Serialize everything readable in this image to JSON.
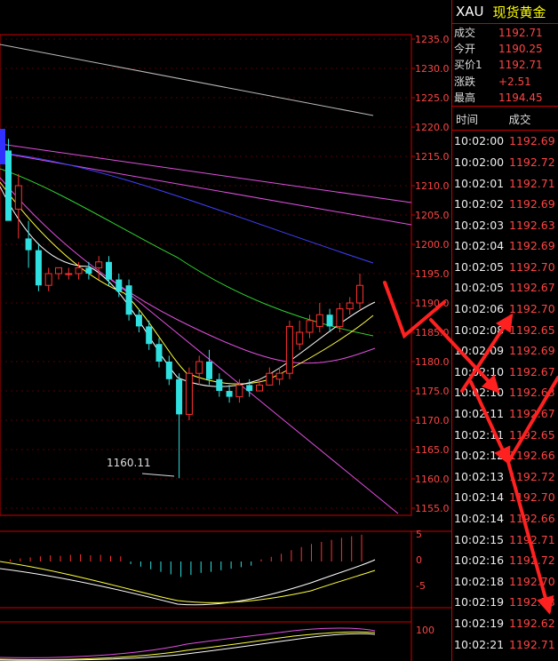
{
  "symbol": "XAU",
  "instrument_name": "现货黄金",
  "quote": [
    {
      "label": "成交",
      "value": "1192.71"
    },
    {
      "label": "今开",
      "value": "1190.25"
    },
    {
      "label": "买价1",
      "value": "1192.71"
    },
    {
      "label": "涨跌",
      "value": "+2.51"
    },
    {
      "label": "最高",
      "value": "1194.45"
    }
  ],
  "ticks_header": {
    "time": "时间",
    "price": "成交"
  },
  "ticks": [
    {
      "time": "10:02:00",
      "price": "1192.69"
    },
    {
      "time": "10:02:00",
      "price": "1192.72"
    },
    {
      "time": "10:02:01",
      "price": "1192.71"
    },
    {
      "time": "10:02:02",
      "price": "1192.69"
    },
    {
      "time": "10:02:03",
      "price": "1192.63"
    },
    {
      "time": "10:02:04",
      "price": "1192.69"
    },
    {
      "time": "10:02:05",
      "price": "1192.70"
    },
    {
      "time": "10:02:05",
      "price": "1192.67"
    },
    {
      "time": "10:02:06",
      "price": "1192.70"
    },
    {
      "time": "10:02:08",
      "price": "1192.65"
    },
    {
      "time": "10:02:09",
      "price": "1192.69"
    },
    {
      "time": "10:02:10",
      "price": "1192.67"
    },
    {
      "time": "10:02:10",
      "price": "1192.63"
    },
    {
      "time": "10:02:11",
      "price": "1192.67"
    },
    {
      "time": "10:02:11",
      "price": "1192.65"
    },
    {
      "time": "10:02:12",
      "price": "1192.66"
    },
    {
      "time": "10:02:13",
      "price": "1192.72"
    },
    {
      "time": "10:02:14",
      "price": "1192.70"
    },
    {
      "time": "10:02:14",
      "price": "1192.66"
    },
    {
      "time": "10:02:15",
      "price": "1192.71"
    },
    {
      "time": "10:02:16",
      "price": "1192.72"
    },
    {
      "time": "10:02:18",
      "price": "1192.70"
    },
    {
      "time": "10:02:19",
      "price": "1192.78"
    },
    {
      "time": "10:02:19",
      "price": "1192.62"
    },
    {
      "time": "10:02:21",
      "price": "1192.71"
    }
  ],
  "price_axis": [
    "1235.0",
    "1230.0",
    "1225.0",
    "1220.0",
    "1215.0",
    "1210.0",
    "1205.0",
    "1200.0",
    "1195.0",
    "1190.0",
    "1185.0",
    "1180.0",
    "1175.0",
    "1170.0",
    "1165.0",
    "1160.0",
    "1155.0"
  ],
  "macd_axis": [
    "5",
    "0",
    "-5"
  ],
  "kdj_axis": [
    "100"
  ],
  "low_label": "1160.11",
  "candles": [
    [
      1216,
      1218,
      1212,
      1204
    ],
    [
      1206,
      1212,
      1201,
      1210
    ],
    [
      1201,
      1204,
      1196,
      1199
    ],
    [
      1199,
      1200,
      1192,
      1193
    ],
    [
      1193,
      1196,
      1192,
      1195
    ],
    [
      1195,
      1196,
      1194,
      1196
    ],
    [
      1195,
      1196,
      1194,
      1195
    ],
    [
      1195,
      1197,
      1194,
      1196
    ],
    [
      1196,
      1197,
      1194,
      1195
    ],
    [
      1196,
      1198,
      1194,
      1197
    ],
    [
      1197,
      1198,
      1193,
      1194
    ],
    [
      1194,
      1195,
      1191,
      1192
    ],
    [
      1193,
      1194,
      1187,
      1188
    ],
    [
      1188,
      1189,
      1185,
      1186
    ],
    [
      1186,
      1187,
      1182,
      1183
    ],
    [
      1183,
      1184,
      1179,
      1180
    ],
    [
      1180,
      1181,
      1176,
      1177
    ],
    [
      1177,
      1178,
      1160.11,
      1171
    ],
    [
      1171,
      1179,
      1170,
      1178
    ],
    [
      1178,
      1181,
      1176,
      1180
    ],
    [
      1180,
      1182,
      1176,
      1177
    ],
    [
      1177,
      1178,
      1174,
      1175
    ],
    [
      1175,
      1176,
      1173,
      1174
    ],
    [
      1174,
      1177,
      1173,
      1176
    ],
    [
      1176,
      1177,
      1174,
      1175
    ],
    [
      1175,
      1177,
      1175,
      1176
    ],
    [
      1176,
      1179,
      1176,
      1178
    ],
    [
      1177,
      1179,
      1176,
      1178
    ],
    [
      1178,
      1187,
      1177,
      1186
    ],
    [
      1183,
      1187,
      1182,
      1185
    ],
    [
      1185,
      1188,
      1184,
      1187
    ],
    [
      1186,
      1190,
      1185,
      1188
    ],
    [
      1188,
      1189,
      1185,
      1186
    ],
    [
      1186,
      1190,
      1185,
      1189
    ],
    [
      1189,
      1191,
      1188,
      1190
    ],
    [
      1190,
      1195,
      1189,
      1193
    ]
  ],
  "macd_bars": [
    0.4,
    0.6,
    0.8,
    1.0,
    1.2,
    1.1,
    1.3,
    1.4,
    1.2,
    1.3,
    1.1,
    1.0,
    -0.5,
    -1.0,
    -1.5,
    -2.0,
    -2.5,
    -3.0,
    -2.6,
    -2.2,
    -2.0,
    -1.7,
    -1.4,
    -1.1,
    -0.8,
    0.4,
    0.9,
    1.5,
    2.2,
    2.8,
    3.4,
    3.8,
    4.2,
    4.6,
    4.9,
    5.2
  ]
}
